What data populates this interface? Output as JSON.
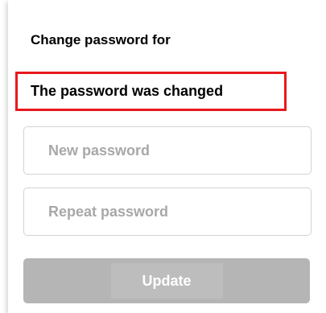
{
  "form": {
    "title": "Change password for",
    "notice": "The password was changed",
    "new_password": {
      "value": "",
      "placeholder": "New password"
    },
    "repeat_password": {
      "value": "",
      "placeholder": "Repeat password"
    },
    "update_label": "Update"
  },
  "colors": {
    "notice_border": "#e8191e",
    "button_bg": "#b5b5b5",
    "button_text": "#ffffff",
    "field_border": "#d3d3d3",
    "placeholder": "#a8a8a8"
  }
}
